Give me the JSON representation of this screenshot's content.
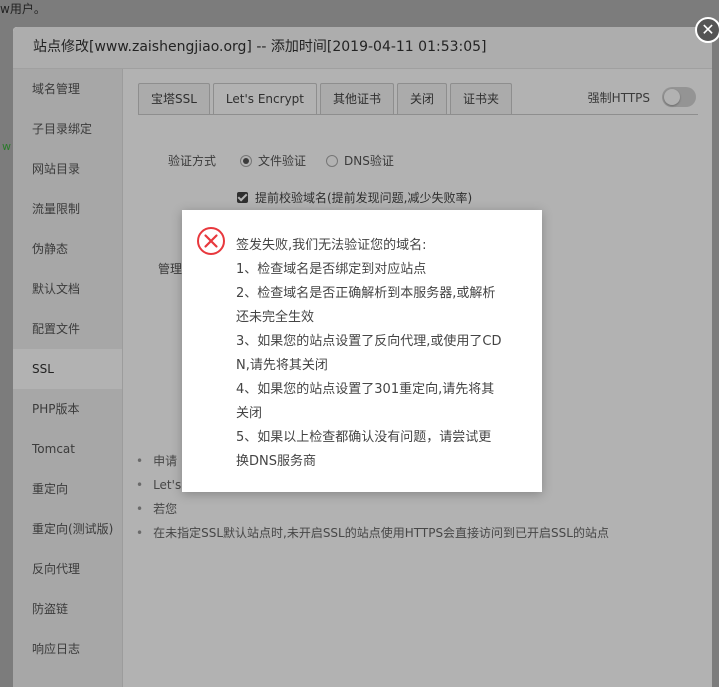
{
  "background": {
    "top_text": "w用户。",
    "side_fragment": "w"
  },
  "dialog": {
    "title": "站点修改[www.zaishengjiao.org] -- 添加时间[2019-04-11 01:53:05]"
  },
  "sidebar": {
    "items": [
      {
        "label": "域名管理"
      },
      {
        "label": "子目录绑定"
      },
      {
        "label": "网站目录"
      },
      {
        "label": "流量限制"
      },
      {
        "label": "伪静态"
      },
      {
        "label": "默认文档"
      },
      {
        "label": "配置文件"
      },
      {
        "label": "SSL"
      },
      {
        "label": "PHP版本"
      },
      {
        "label": "Tomcat"
      },
      {
        "label": "重定向"
      },
      {
        "label": "重定向(测试版)"
      },
      {
        "label": "反向代理"
      },
      {
        "label": "防盗链"
      },
      {
        "label": "响应日志"
      }
    ],
    "active_index": 7
  },
  "tabs": [
    {
      "label": "宝塔SSL"
    },
    {
      "label": "Let's Encrypt"
    },
    {
      "label": "其他证书"
    },
    {
      "label": "关闭"
    },
    {
      "label": "证书夹"
    }
  ],
  "active_tab": 1,
  "force_https": {
    "label": "强制HTTPS",
    "enabled": false
  },
  "ssl_form": {
    "verify_label": "验证方式",
    "option_file": "文件验证",
    "option_dns": "DNS验证",
    "selected": "文件验证",
    "precheck_label": "提前校验域名(提前发现问题,减少失败率)",
    "precheck_checked": true,
    "manage_label": "管理"
  },
  "notes": [
    {
      "text": "申请"
    },
    {
      "text": "Let's"
    },
    {
      "text": "若您"
    },
    {
      "text": "在未指定SSL默认站点时,未开启SSL的站点使用HTTPS会直接访问到已开启SSL的站点"
    }
  ],
  "error_message": {
    "icon": "error-circle-x-icon",
    "lines": [
      "签发失败,我们无法验证您的域名:",
      "1、检查域名是否绑定到对应站点",
      "2、检查域名是否正确解析到本服务器,或解析",
      "还未完全生效",
      "3、如果您的站点设置了反向代理,或使用了CD",
      "N,请先将其关闭",
      "4、如果您的站点设置了301重定向,请先将其",
      "关闭",
      "5、如果以上检查都确认没有问题，请尝试更",
      "换DNS服务商"
    ]
  },
  "colors": {
    "error_red": "#e8383d",
    "overlay": "#7c7c7c"
  }
}
